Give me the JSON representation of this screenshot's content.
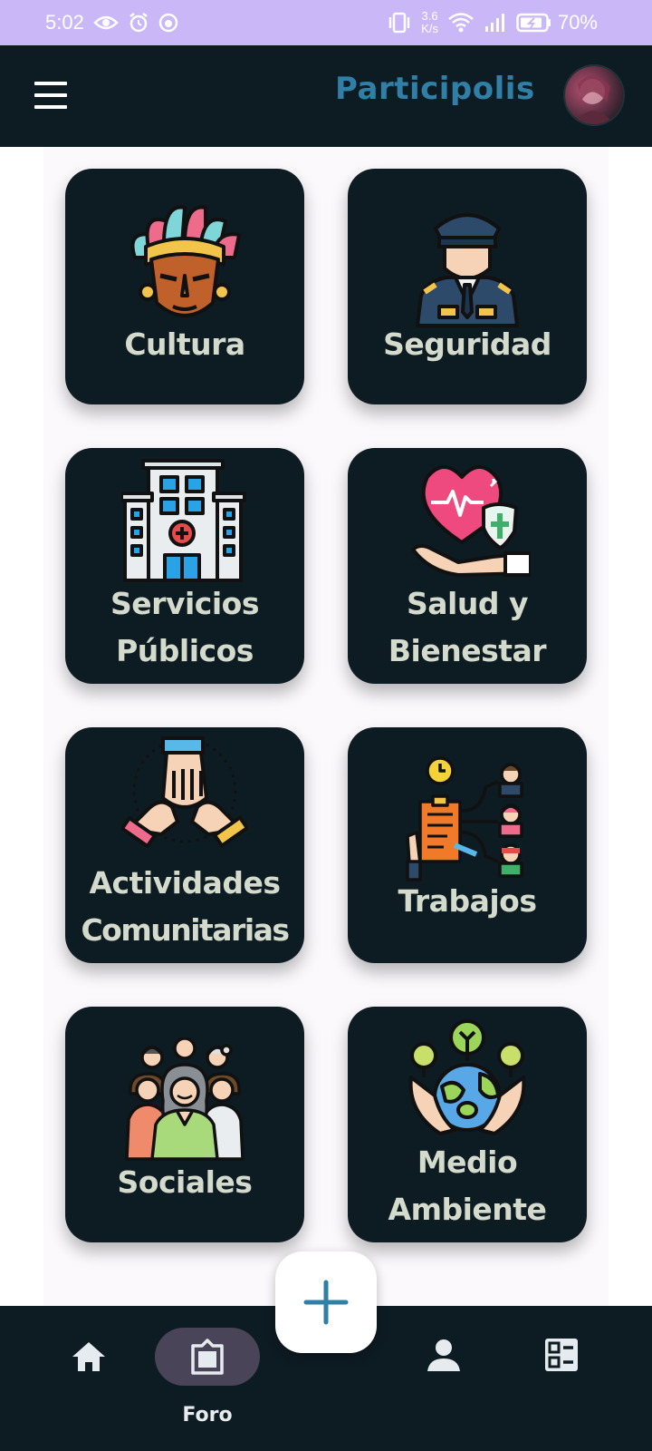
{
  "status_bar": {
    "time": "5:02",
    "net_speed_value": "3.6",
    "net_speed_unit": "K/s",
    "battery": "70%",
    "icons": [
      "eye-icon",
      "alarm-icon",
      "face-icon",
      "vibrate-icon",
      "wifi-icon",
      "signal-icon",
      "battery-icon"
    ]
  },
  "app_bar": {
    "title": "Participolis",
    "title_color": "#2f7fa6",
    "menu_icon": "hamburger-menu-icon"
  },
  "categories": [
    {
      "label_lines": [
        "Cultura"
      ],
      "icon": "indigenous-mask-icon"
    },
    {
      "label_lines": [
        "Seguridad"
      ],
      "icon": "police-officer-icon"
    },
    {
      "label_lines": [
        "Servicios",
        "Públicos"
      ],
      "icon": "hospital-building-icon"
    },
    {
      "label_lines": [
        "Salud y",
        "Bienestar"
      ],
      "icon": "heart-in-hand-icon"
    },
    {
      "label_lines": [
        "Actividades",
        "Comunitarias"
      ],
      "icon": "joined-hands-icon"
    },
    {
      "label_lines": [
        "Trabajos"
      ],
      "icon": "job-assignment-icon"
    },
    {
      "label_lines": [
        "Sociales"
      ],
      "icon": "group-of-people-icon"
    },
    {
      "label_lines": [
        "Medio",
        "Ambiente"
      ],
      "icon": "earth-in-hands-icon"
    }
  ],
  "fab": {
    "icon": "plus-icon",
    "color": "#2f7fa6"
  },
  "bottom_nav": {
    "items": [
      {
        "icon": "home-icon",
        "label": ""
      },
      {
        "icon": "forum-board-icon",
        "label": "Foro",
        "active": true
      },
      {
        "icon": "person-icon",
        "label": ""
      },
      {
        "icon": "dashboard-list-icon",
        "label": ""
      }
    ]
  },
  "colors": {
    "dark": "#0d1b22",
    "card_text": "#d5dbcc",
    "status_bar": "#c9b7f7",
    "active_pill": "#4a4458"
  }
}
